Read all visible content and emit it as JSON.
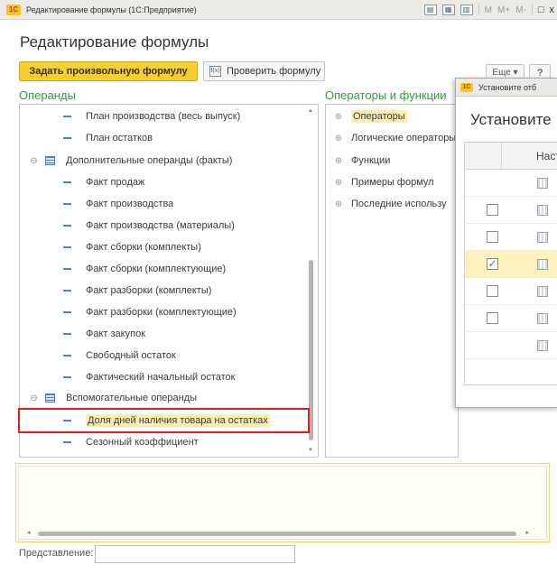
{
  "window": {
    "title": "Редактирование формулы  (1С:Предприятие)",
    "logo": "1С",
    "memory_labels": [
      "M",
      "M+",
      "M-"
    ],
    "toolbar_icons": [
      "save-icon",
      "calculator-icon",
      "calendar-icon",
      "restore-window-icon",
      "close-icon"
    ],
    "close_glyph": "x"
  },
  "page": {
    "title": "Редактирование формулы"
  },
  "toolbar": {
    "set_formula_label": "Задать произвольную формулу",
    "check_formula_label": "Проверить формулу",
    "check_icon_glyph": "f(x)",
    "more_label": "Еще ▾",
    "help_label": "?"
  },
  "operands": {
    "label": "Операнды",
    "items": [
      {
        "type": "leaf",
        "label": "План производства (весь выпуск)"
      },
      {
        "type": "leaf",
        "label": "План остатков"
      },
      {
        "type": "group",
        "label": "Дополнительные операнды (факты)"
      },
      {
        "type": "leaf",
        "label": "Факт продаж"
      },
      {
        "type": "leaf",
        "label": "Факт производства"
      },
      {
        "type": "leaf",
        "label": "Факт производства (материалы)"
      },
      {
        "type": "leaf",
        "label": "Факт сборки (комплекты)"
      },
      {
        "type": "leaf",
        "label": "Факт сборки (комплектующие)"
      },
      {
        "type": "leaf",
        "label": "Факт разборки (комплекты)"
      },
      {
        "type": "leaf",
        "label": "Факт разборки (комплектующие)"
      },
      {
        "type": "leaf",
        "label": "Факт закупок"
      },
      {
        "type": "leaf",
        "label": "Свободный остаток"
      },
      {
        "type": "leaf",
        "label": "Фактический начальный остаток"
      },
      {
        "type": "group",
        "label": "Вспомогательные операнды"
      },
      {
        "type": "leaf",
        "label": "Доля дней наличия товара на остатках",
        "selected": true
      },
      {
        "type": "leaf",
        "label": "Сезонный коэффициент"
      }
    ]
  },
  "operators": {
    "label": "Операторы и функции",
    "items": [
      {
        "label": "Операторы",
        "selected": true
      },
      {
        "label": "Логические операторы"
      },
      {
        "label": "Функции"
      },
      {
        "label": "Примеры формул"
      },
      {
        "label": "Последние использу"
      }
    ]
  },
  "representation": {
    "label": "Представление:",
    "value": ""
  },
  "filter_dialog": {
    "title": "Установите отб",
    "heading": "Установите",
    "column_header": "Наст",
    "rows": [
      {
        "checkbox": false,
        "checked": false,
        "selected": false
      },
      {
        "checkbox": true,
        "checked": false,
        "selected": false
      },
      {
        "checkbox": true,
        "checked": false,
        "selected": false
      },
      {
        "checkbox": true,
        "checked": true,
        "selected": true
      },
      {
        "checkbox": true,
        "checked": false,
        "selected": false
      },
      {
        "checkbox": true,
        "checked": false,
        "selected": false
      },
      {
        "checkbox": false,
        "checked": false,
        "selected": false
      }
    ]
  },
  "colors": {
    "accent_green": "#26a23a",
    "button_yellow": "#f6d030",
    "selection_yellow": "#fbeeb0",
    "highlight_red": "#e31d1d",
    "tree_blue": "#4f7fc8"
  }
}
